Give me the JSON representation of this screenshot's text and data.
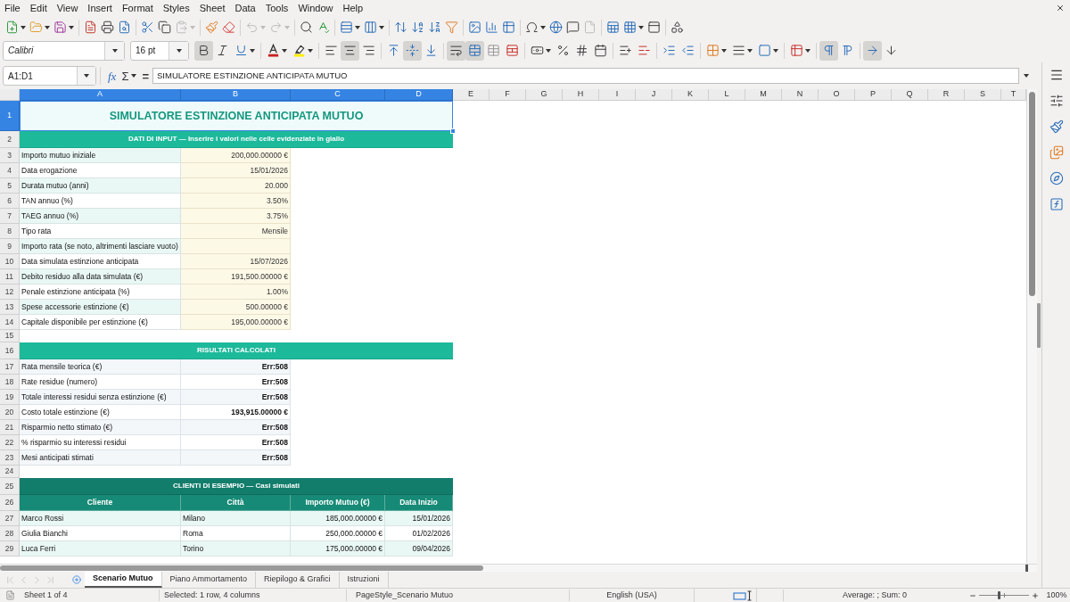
{
  "menu": [
    "File",
    "Edit",
    "View",
    "Insert",
    "Format",
    "Styles",
    "Sheet",
    "Data",
    "Tools",
    "Window",
    "Help"
  ],
  "standard_toolbar": [
    [
      {
        "kind": "new",
        "disabled": false
      },
      {
        "kind": "open",
        "disabled": false
      },
      {
        "kind": "save",
        "disabled": false
      }
    ],
    [
      {
        "kind": "export_pdf",
        "disabled": false
      },
      {
        "kind": "print",
        "disabled": false
      },
      {
        "kind": "print_preview",
        "disabled": false
      }
    ],
    [
      {
        "kind": "cut",
        "disabled": false
      },
      {
        "kind": "copy",
        "disabled": false
      },
      {
        "kind": "paste",
        "disabled": true
      }
    ],
    [
      {
        "kind": "clone",
        "disabled": false
      },
      {
        "kind": "clear",
        "disabled": false
      }
    ],
    [
      {
        "kind": "undo",
        "disabled": true
      },
      {
        "kind": "redo",
        "disabled": true
      }
    ],
    [
      {
        "kind": "find",
        "disabled": false
      },
      {
        "kind": "spelling",
        "disabled": false
      }
    ],
    [
      {
        "kind": "row",
        "disabled": false
      },
      {
        "kind": "column",
        "disabled": false
      }
    ],
    [
      {
        "kind": "sort",
        "disabled": false
      },
      {
        "kind": "sort_ascending",
        "disabled": false
      },
      {
        "kind": "sort_descending",
        "disabled": false
      },
      {
        "kind": "autofilter",
        "disabled": false
      }
    ],
    [
      {
        "kind": "image",
        "disabled": false
      },
      {
        "kind": "chart",
        "disabled": false
      },
      {
        "kind": "pivot_table",
        "disabled": false
      }
    ],
    [
      {
        "kind": "special_character",
        "disabled": false
      },
      {
        "kind": "hyperlink",
        "disabled": false
      },
      {
        "kind": "comment",
        "disabled": false
      },
      {
        "kind": "headers_footers",
        "disabled": true
      }
    ],
    [
      {
        "kind": "print_area",
        "disabled": false
      },
      {
        "kind": "freeze",
        "disabled": false
      },
      {
        "kind": "split",
        "disabled": false
      }
    ],
    [
      {
        "kind": "draw",
        "disabled": false
      }
    ]
  ],
  "format_toolbar": {
    "font_name": "Calibri",
    "font_size": "16 pt",
    "groups": [
      [
        {
          "kind": "bold",
          "on": true
        },
        {
          "kind": "italic",
          "on": false
        },
        {
          "kind": "underline",
          "on": false
        }
      ],
      [
        {
          "kind": "font_color",
          "on": false
        },
        {
          "kind": "highlight",
          "on": false
        }
      ],
      [
        {
          "kind": "align_left",
          "on": false
        },
        {
          "kind": "align_center",
          "on": true
        },
        {
          "kind": "align_right",
          "on": false
        }
      ],
      [
        {
          "kind": "align_top",
          "on": false
        },
        {
          "kind": "align_middle",
          "on": true
        },
        {
          "kind": "align_bottom",
          "on": false
        }
      ],
      [
        {
          "kind": "wrap",
          "on": true
        },
        {
          "kind": "merge_center",
          "on": true
        },
        {
          "kind": "merge",
          "on": false
        },
        {
          "kind": "unmerge",
          "on": false
        }
      ],
      [
        {
          "kind": "currency",
          "on": false
        },
        {
          "kind": "percent",
          "on": false
        },
        {
          "kind": "number",
          "on": false
        },
        {
          "kind": "date",
          "on": false
        }
      ],
      [
        {
          "kind": "add_decimal",
          "on": false
        },
        {
          "kind": "delete_decimal",
          "on": false
        }
      ],
      [
        {
          "kind": "indent_increase",
          "on": false
        },
        {
          "kind": "indent_decrease",
          "on": false
        }
      ],
      [
        {
          "kind": "borders",
          "on": false
        },
        {
          "kind": "border_style",
          "on": false
        },
        {
          "kind": "border_color",
          "on": false
        }
      ],
      [
        {
          "kind": "conditional",
          "on": false
        }
      ],
      [
        {
          "kind": "left_to_right",
          "on": true
        },
        {
          "kind": "right_to_left",
          "on": false
        }
      ],
      [
        {
          "kind": "text_horizontal",
          "on": true
        },
        {
          "kind": "text_vertical",
          "on": false
        }
      ]
    ]
  },
  "formula_bar": {
    "name_box": "A1:D1",
    "buttons": [
      {
        "kind": "function_wizard",
        "text": "fx"
      },
      {
        "kind": "sum",
        "text": "Σ"
      },
      {
        "kind": "formula",
        "text": "="
      }
    ],
    "content": "SIMULATORE ESTINZIONE ANTICIPATA MUTUO"
  },
  "sheet": {
    "columns": [
      {
        "label": "A",
        "selected": true
      },
      {
        "label": "B",
        "selected": true
      },
      {
        "label": "C",
        "selected": true
      },
      {
        "label": "D",
        "selected": true
      },
      {
        "label": "E",
        "selected": false
      },
      {
        "label": "F",
        "selected": false
      },
      {
        "label": "G",
        "selected": false
      },
      {
        "label": "H",
        "selected": false
      },
      {
        "label": "I",
        "selected": false
      },
      {
        "label": "J",
        "selected": false
      },
      {
        "label": "K",
        "selected": false
      },
      {
        "label": "L",
        "selected": false
      },
      {
        "label": "M",
        "selected": false
      },
      {
        "label": "N",
        "selected": false
      },
      {
        "label": "O",
        "selected": false
      },
      {
        "label": "P",
        "selected": false
      },
      {
        "label": "Q",
        "selected": false
      },
      {
        "label": "R",
        "selected": false
      },
      {
        "label": "S",
        "selected": false
      },
      {
        "label": "T",
        "selected": false
      }
    ],
    "rows": [
      {
        "number": "1",
        "selected": true,
        "kind": "title",
        "text": "SIMULATORE ESTINZIONE ANTICIPATA MUTUO"
      },
      {
        "number": "2",
        "selected": false,
        "kind": "section",
        "text": "DATI DI INPUT — Inserire i valori nelle celle evidenziate in giallo"
      },
      {
        "number": "3",
        "selected": false,
        "kind": "input",
        "label": "Importo mutuo iniziale",
        "value": "200,000.00000 €"
      },
      {
        "number": "4",
        "selected": false,
        "kind": "input",
        "label": "Data erogazione",
        "value": "15/01/2026"
      },
      {
        "number": "5",
        "selected": false,
        "kind": "input",
        "label": "Durata mutuo (anni)",
        "value": "20.000"
      },
      {
        "number": "6",
        "selected": false,
        "kind": "input",
        "label": "TAN annuo (%)",
        "value": "3.50%"
      },
      {
        "number": "7",
        "selected": false,
        "kind": "input",
        "label": "TAEG annuo (%)",
        "value": "3.75%"
      },
      {
        "number": "8",
        "selected": false,
        "kind": "input",
        "label": "Tipo rata",
        "value": "Mensile"
      },
      {
        "number": "9",
        "selected": false,
        "kind": "input",
        "label": "Importo rata (se noto, altrimenti lasciare vuoto)"
      },
      {
        "number": "10",
        "selected": false,
        "kind": "input",
        "label": "Data simulata estinzione anticipata",
        "value": "15/07/2026"
      },
      {
        "number": "11",
        "selected": false,
        "kind": "input",
        "label": "Debito residuo alla data simulata (€)",
        "value": "191,500.00000 €"
      },
      {
        "number": "12",
        "selected": false,
        "kind": "input",
        "label": "Penale estinzione anticipata (%)",
        "value": "1.00%"
      },
      {
        "number": "13",
        "selected": false,
        "kind": "input",
        "label": "Spese accessorie estinzione (€)",
        "value": "500.00000 €"
      },
      {
        "number": "14",
        "selected": false,
        "kind": "input",
        "label": "Capitale disponibile per estinzione (€)",
        "value": "195,000.00000 €"
      },
      {
        "number": "15",
        "selected": false,
        "kind": "blank"
      },
      {
        "number": "16",
        "selected": false,
        "kind": "section",
        "text": "RISULTATI CALCOLATI"
      },
      {
        "number": "17",
        "selected": false,
        "kind": "result",
        "label": "Rata mensile teorica (€)",
        "value": "Err:508"
      },
      {
        "number": "18",
        "selected": false,
        "kind": "result",
        "label": "Rate residue (numero)",
        "value": "Err:508"
      },
      {
        "number": "19",
        "selected": false,
        "kind": "result",
        "label": "Totale interessi residui senza estinzione (€)",
        "value": "Err:508"
      },
      {
        "number": "20",
        "selected": false,
        "kind": "result",
        "label": "Costo totale estinzione (€)",
        "value": "193,915.00000 €"
      },
      {
        "number": "21",
        "selected": false,
        "kind": "result",
        "label": "Risparmio netto stimato (€)",
        "value": "Err:508"
      },
      {
        "number": "22",
        "selected": false,
        "kind": "result",
        "label": "% risparmio su interessi residui",
        "value": "Err:508"
      },
      {
        "number": "23",
        "selected": false,
        "kind": "result",
        "label": "Mesi anticipati stimati",
        "value": "Err:508"
      },
      {
        "number": "24",
        "selected": false,
        "kind": "blank"
      },
      {
        "number": "25",
        "selected": false,
        "kind": "table_title",
        "text": "CLIENTI DI ESEMPIO — Casi simulati"
      },
      {
        "number": "26",
        "selected": false,
        "kind": "table_header",
        "cells": [
          "Cliente",
          "Città",
          "Importo Mutuo (€)",
          "Data Inizio"
        ]
      },
      {
        "number": "27",
        "selected": false,
        "kind": "table_row",
        "cells": [
          "Marco Rossi",
          "Milano",
          "185,000.00000 €",
          "15/01/2026"
        ]
      },
      {
        "number": "28",
        "selected": false,
        "kind": "table_row",
        "cells": [
          "Giulia Bianchi",
          "Roma",
          "250,000.00000 €",
          "01/02/2026"
        ]
      },
      {
        "number": "29",
        "selected": false,
        "kind": "table_row",
        "cells": [
          "Luca Ferri",
          "Torino",
          "175,000.00000 €",
          "09/04/2026"
        ]
      }
    ]
  },
  "sheet_tabs": {
    "navigation_disabled": true,
    "tabs": [
      {
        "label": "Scenario Mutuo",
        "selected": true
      },
      {
        "label": "Piano Ammortamento",
        "selected": false
      },
      {
        "label": "Riepilogo & Grafici",
        "selected": false
      },
      {
        "label": "Istruzioni",
        "selected": false
      }
    ]
  },
  "status_bar": {
    "sheet": "Sheet 1 of 4",
    "selection": "Selected: 1 row, 4 columns",
    "page_style": "PageStyle_Scenario Mutuo",
    "language": "English (USA)",
    "summary": "Average: ; Sum: 0",
    "zoom": {
      "level": 0.4,
      "value": "100%"
    }
  }
}
